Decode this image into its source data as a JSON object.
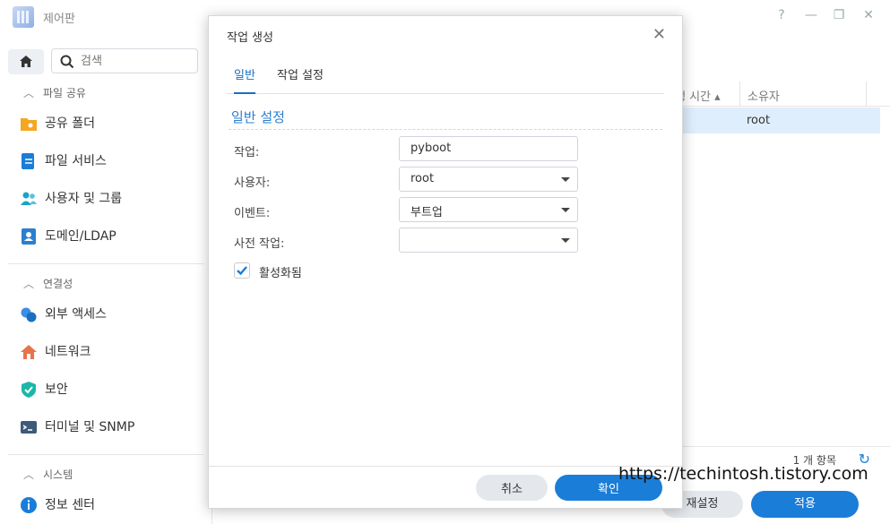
{
  "window": {
    "title": "제어판",
    "help": "?",
    "minimize": "—",
    "restore": "❐",
    "close": "✕"
  },
  "sidebar": {
    "search_placeholder": "검색",
    "sections": [
      {
        "header": "파일 공유",
        "items": [
          {
            "label": "공유 폴더",
            "icon": "shared-folder-icon"
          },
          {
            "label": "파일 서비스",
            "icon": "file-services-icon"
          },
          {
            "label": "사용자 및 그룹",
            "icon": "users-groups-icon"
          },
          {
            "label": "도메인/LDAP",
            "icon": "domain-ldap-icon"
          }
        ]
      },
      {
        "header": "연결성",
        "items": [
          {
            "label": "외부 액세스",
            "icon": "external-access-icon"
          },
          {
            "label": "네트워크",
            "icon": "network-icon"
          },
          {
            "label": "보안",
            "icon": "security-shield-icon"
          },
          {
            "label": "터미널 및 SNMP",
            "icon": "terminal-icon"
          }
        ]
      },
      {
        "header": "시스템",
        "items": [
          {
            "label": "정보 센터",
            "icon": "info-center-icon"
          }
        ]
      }
    ]
  },
  "background": {
    "columns": [
      "행 시간 ▴",
      "소유자"
    ],
    "row_owner": "root",
    "count": "1 개 항목",
    "reset_label": "재설정",
    "apply_label": "적용"
  },
  "dialog": {
    "title": "작업 생성",
    "close": "✕",
    "tabs": [
      "일반",
      "작업 설정"
    ],
    "section_title": "일반 설정",
    "fields": {
      "task_label": "작업:",
      "task_value": "pyboot",
      "user_label": "사용자:",
      "user_value": "root",
      "event_label": "이벤트:",
      "event_value": "부트업",
      "pretask_label": "사전 작업:",
      "pretask_value": ""
    },
    "enabled_label": "활성화됨",
    "enabled": true,
    "cancel_label": "취소",
    "ok_label": "확인"
  },
  "watermark": "https://techintosh.tistory.com",
  "colors": {
    "accent": "#1a7dd8",
    "selected_row": "#dfeefc"
  }
}
